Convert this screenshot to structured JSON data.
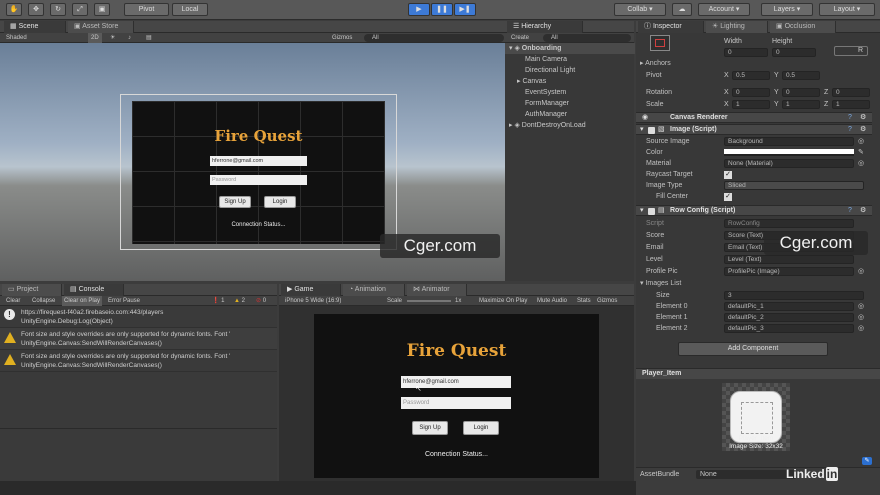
{
  "toolbar": {
    "pivot": "Pivot",
    "local": "Local",
    "collab": "Collab",
    "account": "Account",
    "layers": "Layers",
    "layout": "Layout"
  },
  "scene": {
    "tabs": [
      "Scene",
      "Asset Store"
    ],
    "shading": "Shaded",
    "mode_2d": "2D",
    "gizmos": "Gizmos",
    "search": "All"
  },
  "game_ui": {
    "title": "Fire Quest",
    "email_value": "hferrone@gmail.com",
    "password_placeholder": "Password",
    "signup_label": "Sign Up",
    "login_label": "Login",
    "status": "Connection Status..."
  },
  "hierarchy": {
    "tab": "Hierarchy",
    "create": "Create",
    "search": "All",
    "scene_name": "Onboarding",
    "items": [
      "Main Camera",
      "Directional Light",
      "Canvas",
      "EventSystem",
      "FormManager",
      "AuthManager"
    ],
    "dont_destroy": "DontDestroyOnLoad"
  },
  "inspector": {
    "tabs": [
      "Inspector",
      "Lighting",
      "Occlusion"
    ],
    "width_label": "Width",
    "height_label": "Height",
    "width": "0",
    "height": "0",
    "anchors": "Anchors",
    "pivot_label": "Pivot",
    "pivot_x": "0.5",
    "pivot_y": "0.5",
    "rotation_label": "Rotation",
    "rot_x": "0",
    "rot_y": "0",
    "rot_z": "0",
    "scale_label": "Scale",
    "scale_x": "1",
    "scale_y": "1",
    "scale_z": "1",
    "canvas_renderer": "Canvas Renderer",
    "image_script": "Image (Script)",
    "source_image_label": "Source Image",
    "source_image": "Background",
    "color_label": "Color",
    "material_label": "Material",
    "material": "None (Material)",
    "raycast_label": "Raycast Target",
    "image_type_label": "Image Type",
    "image_type": "Sliced",
    "fill_center_label": "Fill Center",
    "row_config": "Row Config (Script)",
    "script_label": "Script",
    "script": "RowConfig",
    "score_label": "Score",
    "score": "Score (Text)",
    "email_label": "Email",
    "email": "Email (Text)",
    "level_label": "Level",
    "level": "Level (Text)",
    "profile_label": "Profile Pic",
    "profile": "ProfilePic (Image)",
    "images_list": "Images List",
    "size_label": "Size",
    "size": "3",
    "elements": [
      {
        "label": "Element 0",
        "value": "defaultPic_1"
      },
      {
        "label": "Element 1",
        "value": "defaultPic_2"
      },
      {
        "label": "Element 2",
        "value": "defaultPic_3"
      }
    ],
    "add_component": "Add Component",
    "preview_name": "Player_Item",
    "thumb_name": "Player_Item",
    "thumb_size": "Image Size: 32x32",
    "asset_bundle_label": "AssetBundle",
    "asset_bundle": "None"
  },
  "console": {
    "tabs": [
      "Project",
      "Console"
    ],
    "clear": "Clear",
    "collapse": "Collapse",
    "clear_on_play": "Clear on Play",
    "error_pause": "Error Pause",
    "count_info": "1",
    "count_warn": "2",
    "count_err": "0",
    "log_lines": [
      {
        "line1": "https://firequest-f40a2.firebaseio.com:443/players",
        "line2": "UnityEngine.Debug:Log(Object)"
      },
      {
        "line1": "Font size and style overrides are only supported for dynamic fonts. Font '",
        "line2": "UnityEngine.Canvas:SendWillRenderCanvases()"
      },
      {
        "line1": "Font size and style overrides are only supported for dynamic fonts. Font '",
        "line2": "UnityEngine.Canvas:SendWillRenderCanvases()"
      }
    ]
  },
  "game": {
    "tabs": [
      "Game",
      "Animation",
      "Animator"
    ],
    "resolution": "iPhone 5 Wide (16:9)",
    "scale_label": "Scale",
    "scale_value": "1x",
    "maximize": "Maximize On Play",
    "mute": "Mute Audio",
    "stats": "Stats",
    "gizmos": "Gizmos"
  },
  "watermark": "Cger.com",
  "linkedin": "Linked"
}
